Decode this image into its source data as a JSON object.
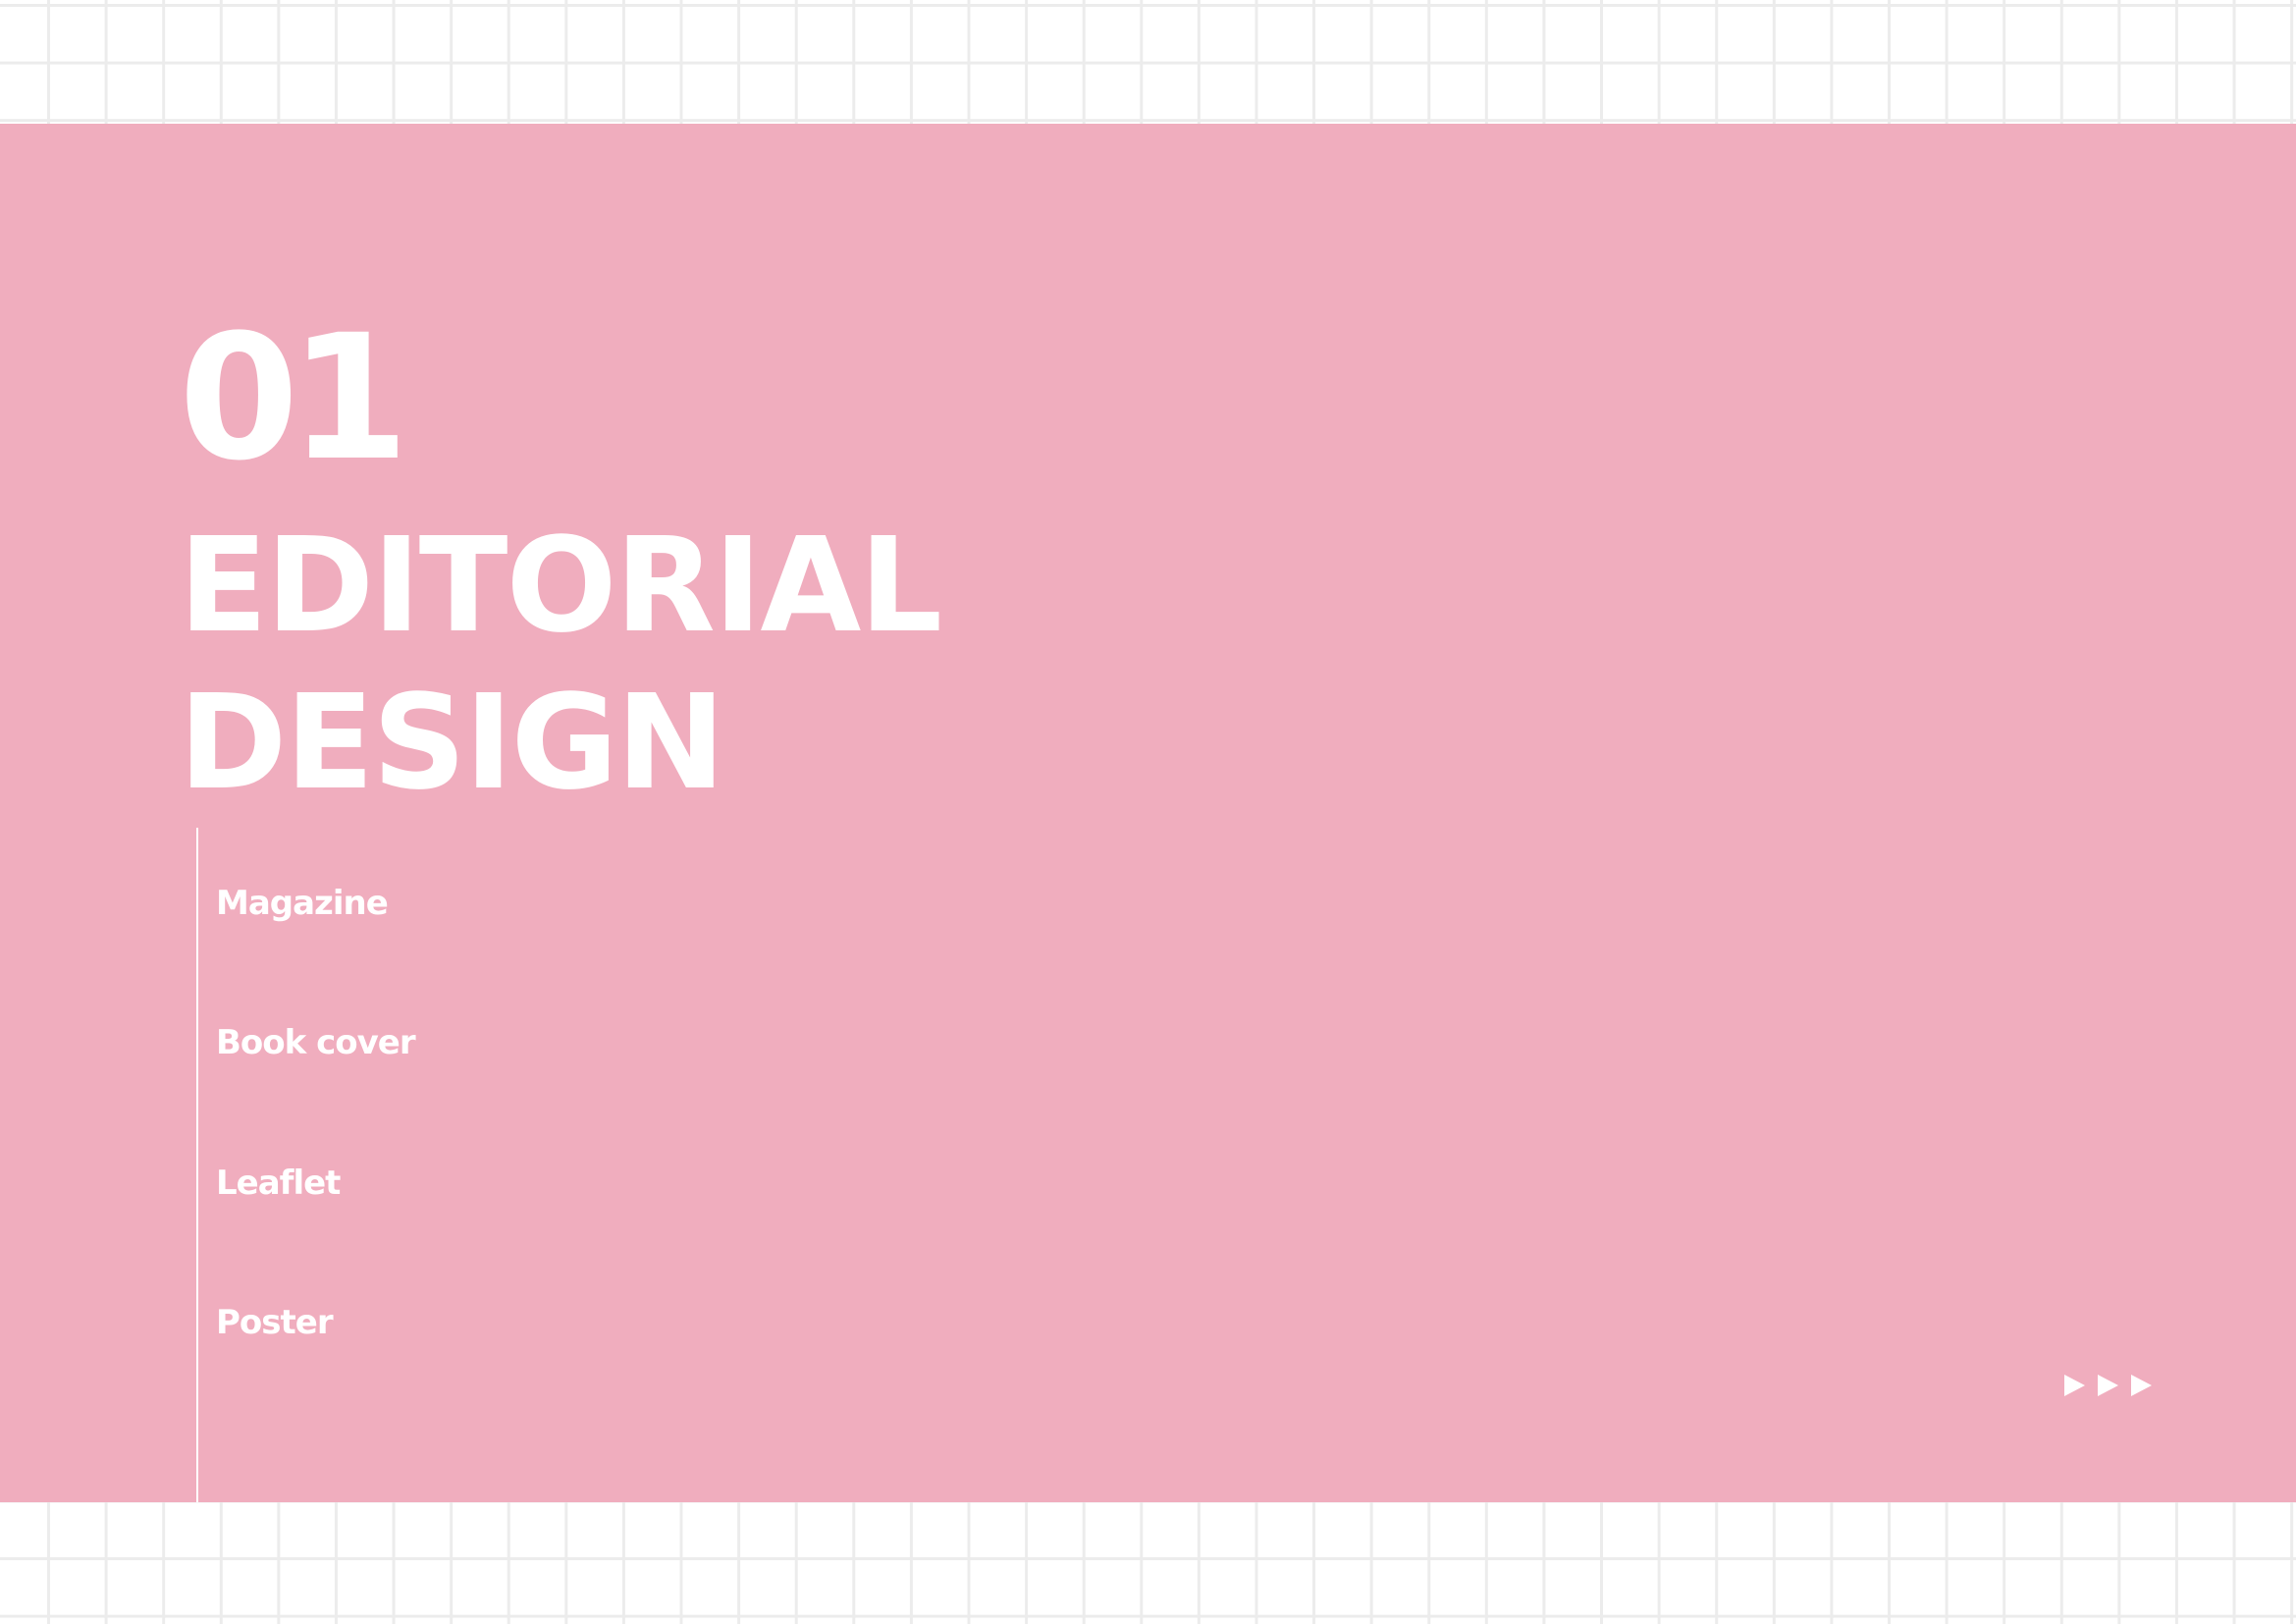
{
  "section": {
    "number": "01",
    "title_line1": "EDITORIAL",
    "title_line2": "DESIGN"
  },
  "items": [
    "Magazine",
    "Book cover",
    "Leaflet",
    "Poster"
  ],
  "icons": {
    "next": "triple-play-arrow-icon"
  },
  "colors": {
    "band": "#f0adbe",
    "text": "#ffffff",
    "grid": "#ececec"
  }
}
